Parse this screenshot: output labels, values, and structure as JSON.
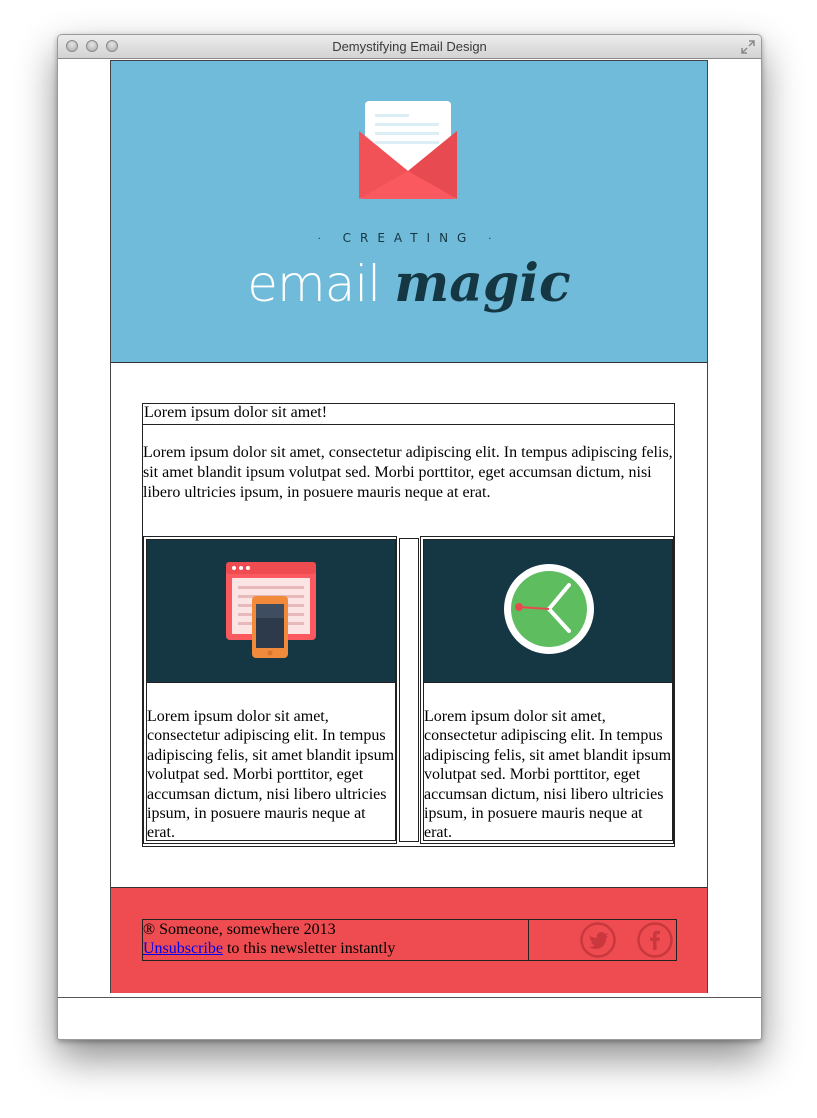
{
  "window": {
    "title": "Demystifying Email Design"
  },
  "header": {
    "creating_label": "CREATING",
    "logo_word_1": "email",
    "logo_word_2": "magic",
    "colors": {
      "background": "#70bbd9",
      "dark": "#153643",
      "accent": "#ee4c50"
    }
  },
  "intro": {
    "heading": "Lorem ipsum dolor sit amet!",
    "text": "Lorem ipsum dolor sit amet, consectetur adipiscing elit. In tempus adipiscing felis, sit amet blandit ipsum volutpat sed. Morbi porttitor, eget accumsan dictum, nisi libero ultricies ipsum, in posuere mauris neque at erat."
  },
  "columns": [
    {
      "icon": "responsive-devices-icon",
      "text": "Lorem ipsum dolor sit amet, consectetur adipiscing elit. In tempus adipiscing felis, sit amet blandit ipsum volutpat sed. Morbi porttitor, eget accumsan dictum, nisi libero ultricies ipsum, in posuere mauris neque at erat."
    },
    {
      "icon": "clock-icon",
      "text": "Lorem ipsum dolor sit amet, consectetur adipiscing elit. In tempus adipiscing felis, sit amet blandit ipsum volutpat sed. Morbi porttitor, eget accumsan dictum, nisi libero ultricies ipsum, in posuere mauris neque at erat."
    }
  ],
  "footer": {
    "copyright": "® Someone, somewhere 2013",
    "unsubscribe_link": "Unsubscribe",
    "unsubscribe_suffix": " to this newsletter instantly",
    "social": [
      {
        "icon": "twitter-icon"
      },
      {
        "icon": "facebook-icon"
      }
    ]
  }
}
